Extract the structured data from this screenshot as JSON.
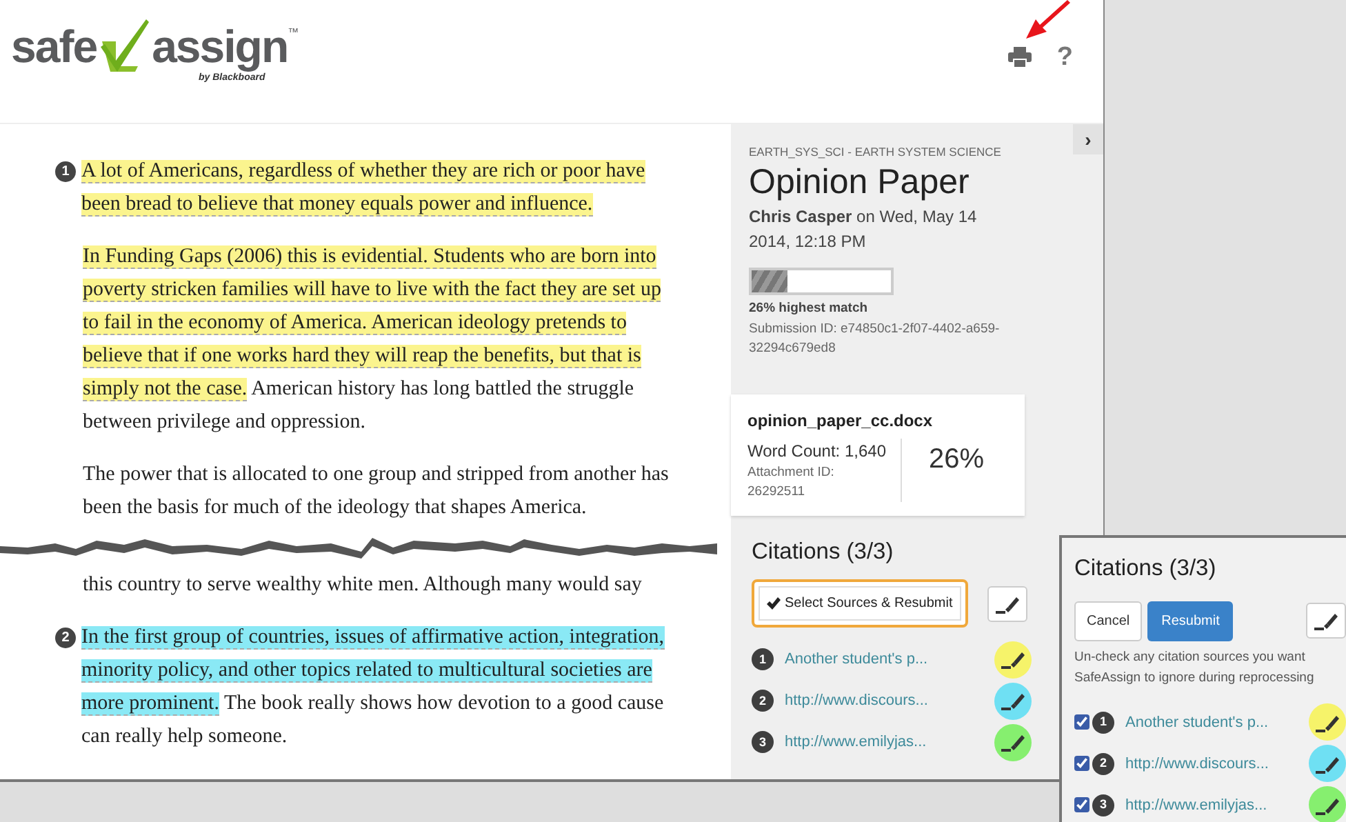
{
  "logo": {
    "word_left": "safe",
    "word_right": "assign",
    "trademark": "™",
    "byline": "by Blackboard"
  },
  "header": {
    "help": "?"
  },
  "document": {
    "paragraphs": [
      {
        "kind": "text",
        "segments": [
          {
            "marker": "1",
            "text": "A lot of Americans, regardless of whether they are rich or poor have been bread to believe that money equals power and influence.",
            "color": "#fbf48e"
          }
        ]
      },
      {
        "kind": "text",
        "segments": [
          {
            "text": "In Funding Gaps (2006) this is evidential.  Students who are born into poverty stricken families will have to live with the fact they are set up to fail in the economy of America.  American ideology pretends to believe that if one works hard they will reap the benefits, but that is simply not the case.",
            "color": "#fbf48e"
          },
          {
            "text": " American history has long battled the struggle between privilege and oppression."
          }
        ]
      },
      {
        "kind": "text",
        "segments": [
          {
            "text": "The power that is allocated to one group and stripped from another has been the basis for much of the ideology that shapes America."
          }
        ]
      },
      {
        "kind": "tear"
      },
      {
        "kind": "text",
        "segments": [
          {
            "text": "this country to serve wealthy white men. Although many would say"
          }
        ]
      },
      {
        "kind": "text",
        "segments": [
          {
            "marker": "2",
            "text": "In the first group of countries, issues of affirmative action, integration, minority policy, and other topics related to multicultural societies are more prominent.",
            "color": "#8ae9f5"
          },
          {
            "text": " The book really shows how devotion to a good cause can really help someone."
          }
        ]
      }
    ]
  },
  "collapse_toggle": "›",
  "submission": {
    "course": "EARTH_SYS_SCI - EARTH SYSTEM SCIENCE",
    "title": "Opinion Paper",
    "byline": "**Chris Casper** on Wed, May 14 2014, 12:18 PM",
    "match_bar": {
      "level": 0.26
    },
    "match_label": "26% highest match",
    "submission_id": "Submission ID: e74850c1-2f07-4402-a659-32294c679ed8"
  },
  "file": {
    "name": "opinion_paper_cc.docx",
    "word_count": "Word Count: 1,640",
    "attachment_label": "Attachment ID:",
    "attachment_id": "26292511",
    "score": "26%"
  },
  "citations": {
    "title": "Citations (3/3)",
    "select_button": "Select Sources & Resubmit",
    "items": [
      {
        "number": "1",
        "label": "Another student's p...",
        "color": "#f6f36a"
      },
      {
        "number": "2",
        "label": "http://www.discours...",
        "color": "#6fe0f3"
      },
      {
        "number": "3",
        "label": "http://www.emilyjas...",
        "color": "#86ef6f"
      }
    ]
  },
  "resubmit_panel": {
    "title": "Citations (3/3)",
    "cancel": "Cancel",
    "resubmit": "Resubmit",
    "hint": "Un-check any citation sources you want SafeAssign to ignore during reprocessing",
    "items": [
      {
        "checked": true,
        "number": "1",
        "label": "Another student's p...",
        "color": "#f6f36a"
      },
      {
        "checked": true,
        "number": "2",
        "label": "http://www.discours...",
        "color": "#6fe0f3"
      },
      {
        "checked": true,
        "number": "3",
        "label": "http://www.emilyjas...",
        "color": "#86ef6f"
      }
    ]
  }
}
